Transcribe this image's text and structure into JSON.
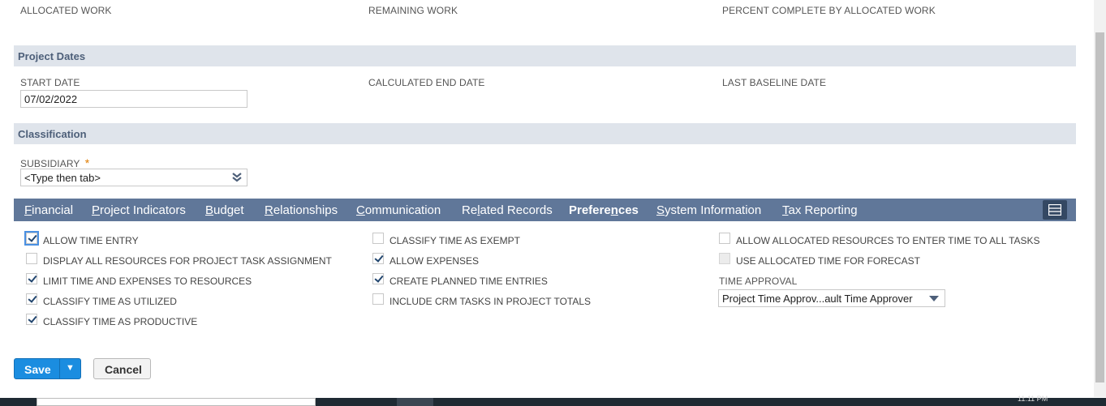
{
  "work": {
    "allocated_label": "ALLOCATED WORK",
    "remaining_label": "REMAINING WORK",
    "percent_label": "PERCENT COMPLETE BY ALLOCATED WORK"
  },
  "project_dates": {
    "title": "Project Dates",
    "start_label": "START DATE",
    "start_value": "07/02/2022",
    "end_label": "CALCULATED END DATE",
    "baseline_label": "LAST BASELINE DATE"
  },
  "classification": {
    "title": "Classification",
    "subsidiary_label": "SUBSIDIARY",
    "required_mark": "*",
    "subsidiary_value": "<Type then tab>"
  },
  "tabs": [
    {
      "first": "F",
      "rest": "inancial"
    },
    {
      "first": "P",
      "rest": "roject Indicators"
    },
    {
      "first": "B",
      "rest": "udget"
    },
    {
      "first": "R",
      "rest": "elationships"
    },
    {
      "first": "C",
      "rest": "ommunication"
    },
    {
      "pre": "Re",
      "first": "l",
      "rest": "ated Records"
    },
    {
      "pre": "Prefere",
      "first": "n",
      "rest": "ces"
    },
    {
      "first": "S",
      "rest": "ystem Information"
    },
    {
      "first": "T",
      "rest": "ax Reporting"
    }
  ],
  "preferences": {
    "col1": [
      {
        "label": "ALLOW TIME ENTRY",
        "checked": true
      },
      {
        "label": "DISPLAY ALL RESOURCES FOR PROJECT TASK ASSIGNMENT",
        "checked": false
      },
      {
        "label": "LIMIT TIME AND EXPENSES TO RESOURCES",
        "checked": true
      },
      {
        "label": "CLASSIFY TIME AS UTILIZED",
        "checked": true
      },
      {
        "label": "CLASSIFY TIME AS PRODUCTIVE",
        "checked": true
      }
    ],
    "col2": [
      {
        "label": "CLASSIFY TIME AS EXEMPT",
        "checked": false
      },
      {
        "label": "ALLOW EXPENSES",
        "checked": true
      },
      {
        "label": "CREATE PLANNED TIME ENTRIES",
        "checked": true
      },
      {
        "label": "INCLUDE CRM TASKS IN PROJECT TOTALS",
        "checked": false
      }
    ],
    "col3": [
      {
        "label": "ALLOW ALLOCATED RESOURCES TO ENTER TIME TO ALL TASKS",
        "checked": false
      },
      {
        "label": "USE ALLOCATED TIME FOR FORECAST",
        "checked": false,
        "disabled": true
      }
    ],
    "time_approval_label": "TIME APPROVAL",
    "time_approval_value": "Project Time Approv...ault Time Approver"
  },
  "buttons": {
    "save": "Save",
    "save_menu": "▼",
    "cancel": "Cancel"
  },
  "taskbar": {
    "clock": "11:11 PM"
  }
}
